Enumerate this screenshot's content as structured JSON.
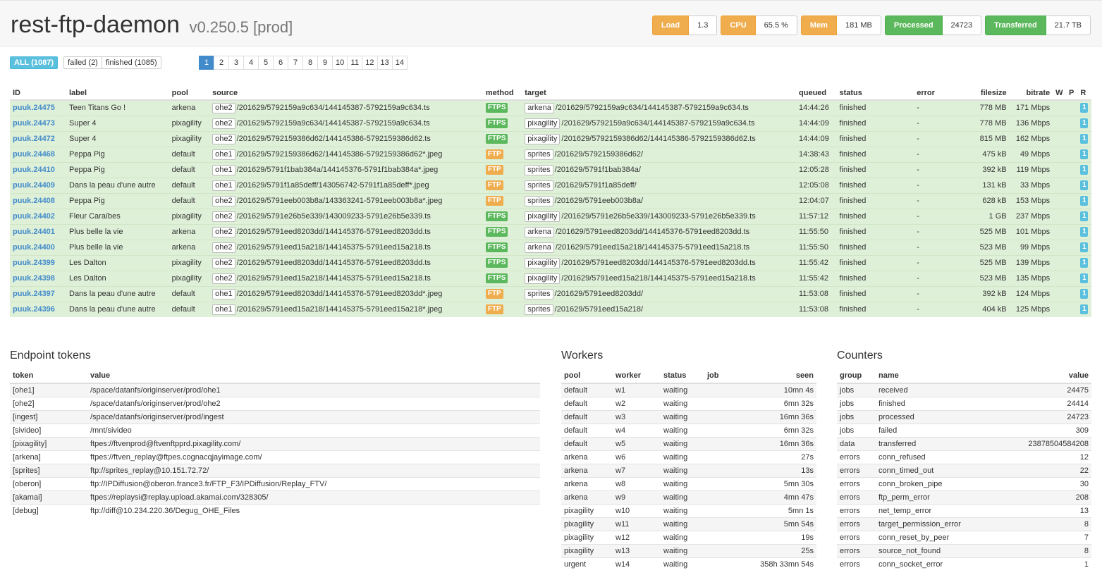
{
  "header": {
    "title": "rest-ftp-daemon",
    "version": "v0.250.5 [prod]",
    "stats": [
      {
        "label": "Load",
        "value": "1.3",
        "color": "#f0ad4e"
      },
      {
        "label": "CPU",
        "value": "65.5 %",
        "color": "#f0ad4e"
      },
      {
        "label": "Mem",
        "value": "181 MB",
        "color": "#f0ad4e"
      },
      {
        "label": "Processed",
        "value": "24723",
        "color": "#5cb85c"
      },
      {
        "label": "Transferred",
        "value": "21.7 TB",
        "color": "#5cb85c"
      }
    ]
  },
  "filters": {
    "all": "ALL (1087)",
    "failed": "failed (2)",
    "finished": "finished (1085)"
  },
  "pager": {
    "pages": [
      "1",
      "2",
      "3",
      "4",
      "5",
      "6",
      "7",
      "8",
      "9",
      "10",
      "11",
      "12",
      "13",
      "14"
    ],
    "current": "1"
  },
  "jobs": {
    "columns": [
      "ID",
      "label",
      "pool",
      "source",
      "method",
      "target",
      "queued",
      "status",
      "error",
      "filesize",
      "bitrate",
      "W",
      "P",
      "R"
    ],
    "rows": [
      {
        "id": "puuk.24475",
        "label": "Teen Titans Go !",
        "pool": "arkena",
        "src_tag": "ohe2",
        "src": "/201629/5792159a9c634/144145387-5792159a9c634.ts",
        "method": "FTPS",
        "tgt_tag": "arkena",
        "tgt": "/201629/5792159a9c634/144145387-5792159a9c634.ts",
        "queued": "14:44:26",
        "status": "finished",
        "error": "-",
        "filesize": "778 MB",
        "bitrate": "171 Mbps",
        "r": "1"
      },
      {
        "id": "puuk.24473",
        "label": "Super 4",
        "pool": "pixagility",
        "src_tag": "ohe2",
        "src": "/201629/5792159a9c634/144145387-5792159a9c634.ts",
        "method": "FTPS",
        "tgt_tag": "pixagility",
        "tgt": "/201629/5792159a9c634/144145387-5792159a9c634.ts",
        "queued": "14:44:09",
        "status": "finished",
        "error": "-",
        "filesize": "778 MB",
        "bitrate": "136 Mbps",
        "r": "1"
      },
      {
        "id": "puuk.24472",
        "label": "Super 4",
        "pool": "pixagility",
        "src_tag": "ohe2",
        "src": "/201629/5792159386d62/144145386-5792159386d62.ts",
        "method": "FTPS",
        "tgt_tag": "pixagility",
        "tgt": "/201629/5792159386d62/144145386-5792159386d62.ts",
        "queued": "14:44:09",
        "status": "finished",
        "error": "-",
        "filesize": "815 MB",
        "bitrate": "162 Mbps",
        "r": "1"
      },
      {
        "id": "puuk.24468",
        "label": "Peppa Pig",
        "pool": "default",
        "src_tag": "ohe1",
        "src": "/201629/5792159386d62/144145386-5792159386d62*.jpeg",
        "method": "FTP",
        "tgt_tag": "sprites",
        "tgt": "/201629/5792159386d62/",
        "queued": "14:38:43",
        "status": "finished",
        "error": "-",
        "filesize": "475 kB",
        "bitrate": "49 Mbps",
        "r": "1"
      },
      {
        "id": "puuk.24410",
        "label": "Peppa Pig",
        "pool": "default",
        "src_tag": "ohe1",
        "src": "/201629/5791f1bab384a/144145376-5791f1bab384a*.jpeg",
        "method": "FTP",
        "tgt_tag": "sprites",
        "tgt": "/201629/5791f1bab384a/",
        "queued": "12:05:28",
        "status": "finished",
        "error": "-",
        "filesize": "392 kB",
        "bitrate": "119 Mbps",
        "r": "1"
      },
      {
        "id": "puuk.24409",
        "label": "Dans la peau d'une autre",
        "pool": "default",
        "src_tag": "ohe1",
        "src": "/201629/5791f1a85deff/143056742-5791f1a85deff*.jpeg",
        "method": "FTP",
        "tgt_tag": "sprites",
        "tgt": "/201629/5791f1a85deff/",
        "queued": "12:05:08",
        "status": "finished",
        "error": "-",
        "filesize": "131 kB",
        "bitrate": "33 Mbps",
        "r": "1"
      },
      {
        "id": "puuk.24408",
        "label": "Peppa Pig",
        "pool": "default",
        "src_tag": "ohe2",
        "src": "/201629/5791eeb003b8a/143363241-5791eeb003b8a*.jpeg",
        "method": "FTP",
        "tgt_tag": "sprites",
        "tgt": "/201629/5791eeb003b8a/",
        "queued": "12:04:07",
        "status": "finished",
        "error": "-",
        "filesize": "628 kB",
        "bitrate": "153 Mbps",
        "r": "1"
      },
      {
        "id": "puuk.24402",
        "label": "Fleur Caraïbes",
        "pool": "pixagility",
        "src_tag": "ohe2",
        "src": "/201629/5791e26b5e339/143009233-5791e26b5e339.ts",
        "method": "FTPS",
        "tgt_tag": "pixagility",
        "tgt": "/201629/5791e26b5e339/143009233-5791e26b5e339.ts",
        "queued": "11:57:12",
        "status": "finished",
        "error": "-",
        "filesize": "1 GB",
        "bitrate": "237 Mbps",
        "r": "1"
      },
      {
        "id": "puuk.24401",
        "label": "Plus belle la vie",
        "pool": "arkena",
        "src_tag": "ohe2",
        "src": "/201629/5791eed8203dd/144145376-5791eed8203dd.ts",
        "method": "FTPS",
        "tgt_tag": "arkena",
        "tgt": "/201629/5791eed8203dd/144145376-5791eed8203dd.ts",
        "queued": "11:55:50",
        "status": "finished",
        "error": "-",
        "filesize": "525 MB",
        "bitrate": "101 Mbps",
        "r": "1"
      },
      {
        "id": "puuk.24400",
        "label": "Plus belle la vie",
        "pool": "arkena",
        "src_tag": "ohe2",
        "src": "/201629/5791eed15a218/144145375-5791eed15a218.ts",
        "method": "FTPS",
        "tgt_tag": "arkena",
        "tgt": "/201629/5791eed15a218/144145375-5791eed15a218.ts",
        "queued": "11:55:50",
        "status": "finished",
        "error": "-",
        "filesize": "523 MB",
        "bitrate": "99 Mbps",
        "r": "1"
      },
      {
        "id": "puuk.24399",
        "label": "Les Dalton",
        "pool": "pixagility",
        "src_tag": "ohe2",
        "src": "/201629/5791eed8203dd/144145376-5791eed8203dd.ts",
        "method": "FTPS",
        "tgt_tag": "pixagility",
        "tgt": "/201629/5791eed8203dd/144145376-5791eed8203dd.ts",
        "queued": "11:55:42",
        "status": "finished",
        "error": "-",
        "filesize": "525 MB",
        "bitrate": "139 Mbps",
        "r": "1"
      },
      {
        "id": "puuk.24398",
        "label": "Les Dalton",
        "pool": "pixagility",
        "src_tag": "ohe2",
        "src": "/201629/5791eed15a218/144145375-5791eed15a218.ts",
        "method": "FTPS",
        "tgt_tag": "pixagility",
        "tgt": "/201629/5791eed15a218/144145375-5791eed15a218.ts",
        "queued": "11:55:42",
        "status": "finished",
        "error": "-",
        "filesize": "523 MB",
        "bitrate": "135 Mbps",
        "r": "1"
      },
      {
        "id": "puuk.24397",
        "label": "Dans la peau d'une autre",
        "pool": "default",
        "src_tag": "ohe1",
        "src": "/201629/5791eed8203dd/144145376-5791eed8203dd*.jpeg",
        "method": "FTP",
        "tgt_tag": "sprites",
        "tgt": "/201629/5791eed8203dd/",
        "queued": "11:53:08",
        "status": "finished",
        "error": "-",
        "filesize": "392 kB",
        "bitrate": "124 Mbps",
        "r": "1"
      },
      {
        "id": "puuk.24396",
        "label": "Dans la peau d'une autre",
        "pool": "default",
        "src_tag": "ohe1",
        "src": "/201629/5791eed15a218/144145375-5791eed15a218*.jpeg",
        "method": "FTP",
        "tgt_tag": "sprites",
        "tgt": "/201629/5791eed15a218/",
        "queued": "11:53:08",
        "status": "finished",
        "error": "-",
        "filesize": "404 kB",
        "bitrate": "125 Mbps",
        "r": "1"
      }
    ]
  },
  "endpoints": {
    "title": "Endpoint tokens",
    "columns": [
      "token",
      "value"
    ],
    "rows": [
      {
        "token": "[ohe1]",
        "value": "/space/datanfs/originserver/prod/ohe1"
      },
      {
        "token": "[ohe2]",
        "value": "/space/datanfs/originserver/prod/ohe2"
      },
      {
        "token": "[ingest]",
        "value": "/space/datanfs/originserver/prod/ingest"
      },
      {
        "token": "[sivideo]",
        "value": "/mnt/sivideo"
      },
      {
        "token": "[pixagility]",
        "value": "ftpes://ftvenprod@ftvenftpprd.pixagility.com/"
      },
      {
        "token": "[arkena]",
        "value": "ftpes://ftven_replay@ftpes.cognacqjayimage.com/"
      },
      {
        "token": "[sprites]",
        "value": "ftp://sprites_replay@10.151.72.72/"
      },
      {
        "token": "[oberon]",
        "value": "ftp://IPDiffusion@oberon.france3.fr/FTP_F3/IPDiffusion/Replay_FTV/"
      },
      {
        "token": "[akamai]",
        "value": "ftpes://replaysi@replay.upload.akamai.com/328305/"
      },
      {
        "token": "[debug]",
        "value": "ftp://diff@10.234.220.36/Degug_OHE_Files"
      }
    ]
  },
  "workers": {
    "title": "Workers",
    "columns": [
      "pool",
      "worker",
      "status",
      "job",
      "seen"
    ],
    "rows": [
      {
        "pool": "default",
        "worker": "w1",
        "status": "waiting",
        "job": "",
        "seen": "10mn 4s"
      },
      {
        "pool": "default",
        "worker": "w2",
        "status": "waiting",
        "job": "",
        "seen": "6mn 32s"
      },
      {
        "pool": "default",
        "worker": "w3",
        "status": "waiting",
        "job": "",
        "seen": "16mn 36s"
      },
      {
        "pool": "default",
        "worker": "w4",
        "status": "waiting",
        "job": "",
        "seen": "6mn 32s"
      },
      {
        "pool": "default",
        "worker": "w5",
        "status": "waiting",
        "job": "",
        "seen": "16mn 36s"
      },
      {
        "pool": "arkena",
        "worker": "w6",
        "status": "waiting",
        "job": "",
        "seen": "27s"
      },
      {
        "pool": "arkena",
        "worker": "w7",
        "status": "waiting",
        "job": "",
        "seen": "13s"
      },
      {
        "pool": "arkena",
        "worker": "w8",
        "status": "waiting",
        "job": "",
        "seen": "5mn 30s"
      },
      {
        "pool": "arkena",
        "worker": "w9",
        "status": "waiting",
        "job": "",
        "seen": "4mn 47s"
      },
      {
        "pool": "pixagility",
        "worker": "w10",
        "status": "waiting",
        "job": "",
        "seen": "5mn 1s"
      },
      {
        "pool": "pixagility",
        "worker": "w11",
        "status": "waiting",
        "job": "",
        "seen": "5mn 54s"
      },
      {
        "pool": "pixagility",
        "worker": "w12",
        "status": "waiting",
        "job": "",
        "seen": "19s"
      },
      {
        "pool": "pixagility",
        "worker": "w13",
        "status": "waiting",
        "job": "",
        "seen": "25s"
      },
      {
        "pool": "urgent",
        "worker": "w14",
        "status": "waiting",
        "job": "",
        "seen": "358h 33mn 54s"
      }
    ]
  },
  "counters": {
    "title": "Counters",
    "columns": [
      "group",
      "name",
      "value"
    ],
    "rows": [
      {
        "group": "jobs",
        "name": "received",
        "value": "24475"
      },
      {
        "group": "jobs",
        "name": "finished",
        "value": "24414"
      },
      {
        "group": "jobs",
        "name": "processed",
        "value": "24723"
      },
      {
        "group": "jobs",
        "name": "failed",
        "value": "309"
      },
      {
        "group": "data",
        "name": "transferred",
        "value": "23878504584208"
      },
      {
        "group": "errors",
        "name": "conn_refused",
        "value": "12"
      },
      {
        "group": "errors",
        "name": "conn_timed_out",
        "value": "22"
      },
      {
        "group": "errors",
        "name": "conn_broken_pipe",
        "value": "30"
      },
      {
        "group": "errors",
        "name": "ftp_perm_error",
        "value": "208"
      },
      {
        "group": "errors",
        "name": "net_temp_error",
        "value": "13"
      },
      {
        "group": "errors",
        "name": "target_permission_error",
        "value": "8"
      },
      {
        "group": "errors",
        "name": "conn_reset_by_peer",
        "value": "7"
      },
      {
        "group": "errors",
        "name": "source_not_found",
        "value": "8"
      },
      {
        "group": "errors",
        "name": "conn_socket_error",
        "value": "1"
      }
    ]
  }
}
